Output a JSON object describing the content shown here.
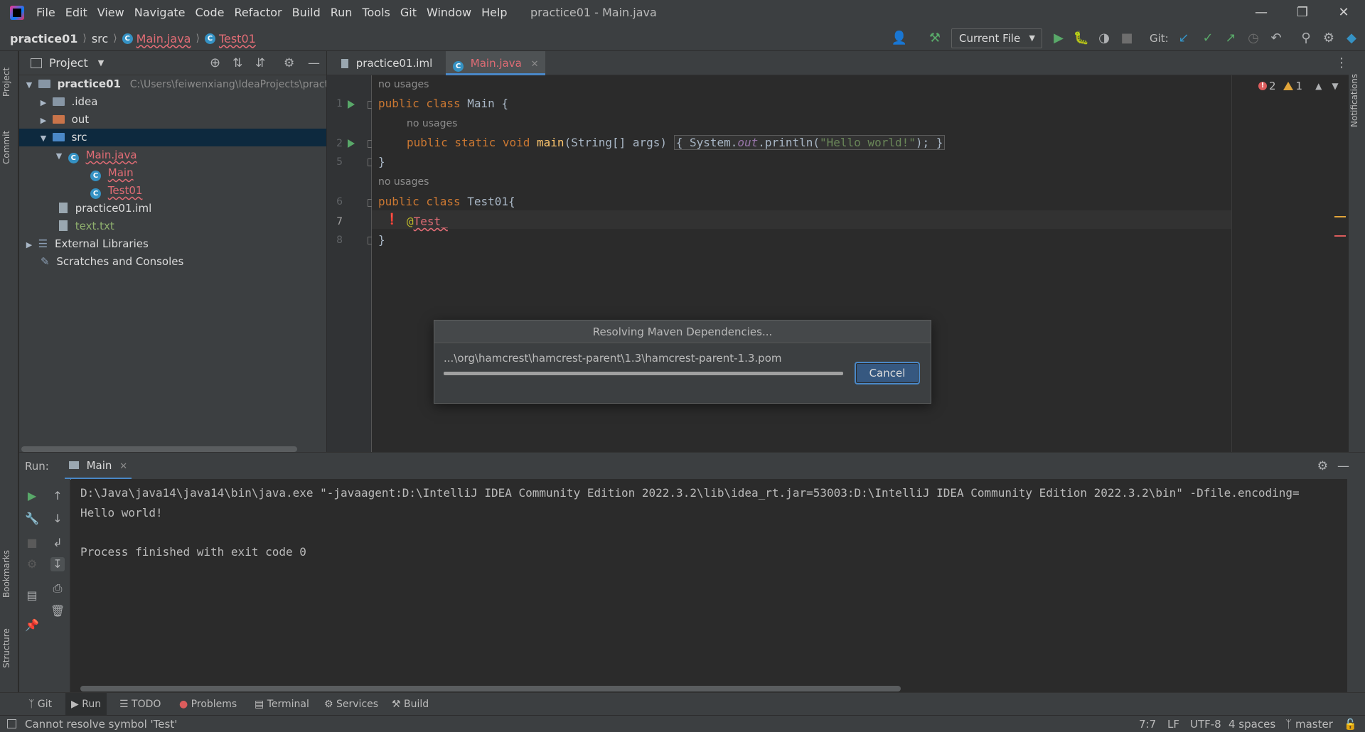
{
  "app": {
    "window_title": "practice01 - Main.java",
    "menu": [
      "File",
      "Edit",
      "View",
      "Navigate",
      "Code",
      "Refactor",
      "Build",
      "Run",
      "Tools",
      "Git",
      "Window",
      "Help"
    ]
  },
  "breadcrumb": [
    "practice01",
    "src",
    "Main.java",
    "Test01"
  ],
  "toolbar": {
    "run_config": "Current File",
    "git_label": "Git:"
  },
  "side_tabs": {
    "project": "Project",
    "commit": "Commit",
    "bookmarks": "Bookmarks",
    "structure": "Structure",
    "notifications": "Notifications"
  },
  "project": {
    "title": "Project",
    "tree": [
      {
        "label": "practice01",
        "hint": "C:\\Users\\feiwenxiang\\IdeaProjects\\pract"
      },
      {
        "label": ".idea"
      },
      {
        "label": "out"
      },
      {
        "label": "src"
      },
      {
        "label": "Main.java"
      },
      {
        "label": "Main"
      },
      {
        "label": "Test01"
      },
      {
        "label": "practice01.iml"
      },
      {
        "label": "text.txt"
      },
      {
        "label": "External Libraries"
      },
      {
        "label": "Scratches and Consoles"
      }
    ]
  },
  "editor": {
    "tabs": [
      {
        "label": "practice01.iml"
      },
      {
        "label": "Main.java"
      }
    ],
    "usage_hint": "no usages",
    "line_numbers": [
      "1",
      "2",
      "5",
      "6",
      "7",
      "8"
    ],
    "code": {
      "l1_kw": "public class",
      "l1_name": " Main {",
      "l2_kw": "public static void",
      "l2_fn": "main",
      "l2_args": "(String[] args) ",
      "l2_body_pre": "{ System.",
      "l2_out": "out",
      "l2_call": ".println(",
      "l2_str": "\"Hello world!\"",
      "l2_end": "); }",
      "l5": "}",
      "l6_kw": "public class",
      "l6_name": " Test01{",
      "l7_at": "@",
      "l7_ann": "Test_",
      "l8": "}"
    },
    "errors": "2",
    "warnings": "1"
  },
  "modal": {
    "title": "Resolving Maven Dependencies...",
    "path": "...\\org\\hamcrest\\hamcrest-parent\\1.3\\hamcrest-parent-1.3.pom",
    "progress": 1.0,
    "cancel_label": "Cancel"
  },
  "run": {
    "label": "Run:",
    "tab": "Main",
    "console": [
      "D:\\Java\\java14\\java14\\bin\\java.exe \"-javaagent:D:\\IntelliJ IDEA Community Edition 2022.3.2\\lib\\idea_rt.jar=53003:D:\\IntelliJ IDEA Community Edition 2022.3.2\\bin\" -Dfile.encoding=",
      "Hello world!",
      "",
      "Process finished with exit code 0"
    ]
  },
  "bottom_tools": [
    "Git",
    "Run",
    "TODO",
    "Problems",
    "Terminal",
    "Services",
    "Build"
  ],
  "status": {
    "message": "Cannot resolve symbol 'Test'",
    "position": "7:7",
    "line_sep": "LF",
    "encoding": "UTF-8",
    "indent": "4 spaces",
    "branch": "master"
  }
}
